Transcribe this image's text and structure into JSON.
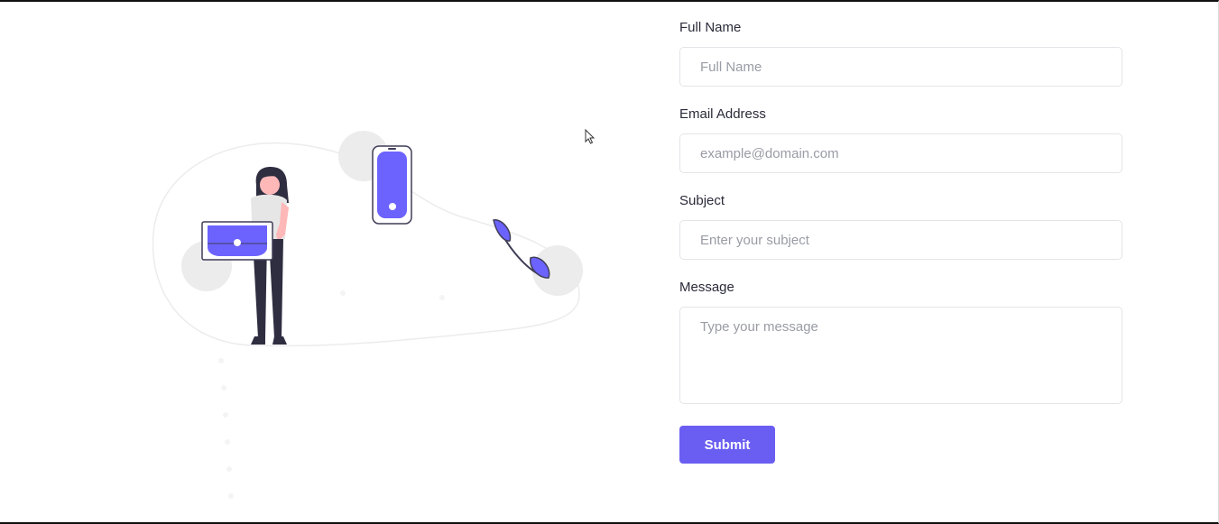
{
  "form": {
    "full_name": {
      "label": "Full Name",
      "placeholder": "Full Name",
      "value": ""
    },
    "email": {
      "label": "Email Address",
      "placeholder": "example@domain.com",
      "value": ""
    },
    "subject": {
      "label": "Subject",
      "placeholder": "Enter your subject",
      "value": ""
    },
    "message": {
      "label": "Message",
      "placeholder": "Type your message",
      "value": ""
    },
    "submit_label": "Submit"
  },
  "colors": {
    "accent": "#6a5ef2",
    "illustration_purple": "#6c63ff",
    "blob_grey": "#f2f2f2",
    "hair": "#2f2e41",
    "skin": "#ffb8b8",
    "label_text": "#2b2b3a",
    "placeholder_text": "#9a9ca5",
    "input_border": "#e3e4e8"
  },
  "icons": {
    "illustration": "contact-us-illustration",
    "cursor": "mouse-pointer-icon"
  }
}
